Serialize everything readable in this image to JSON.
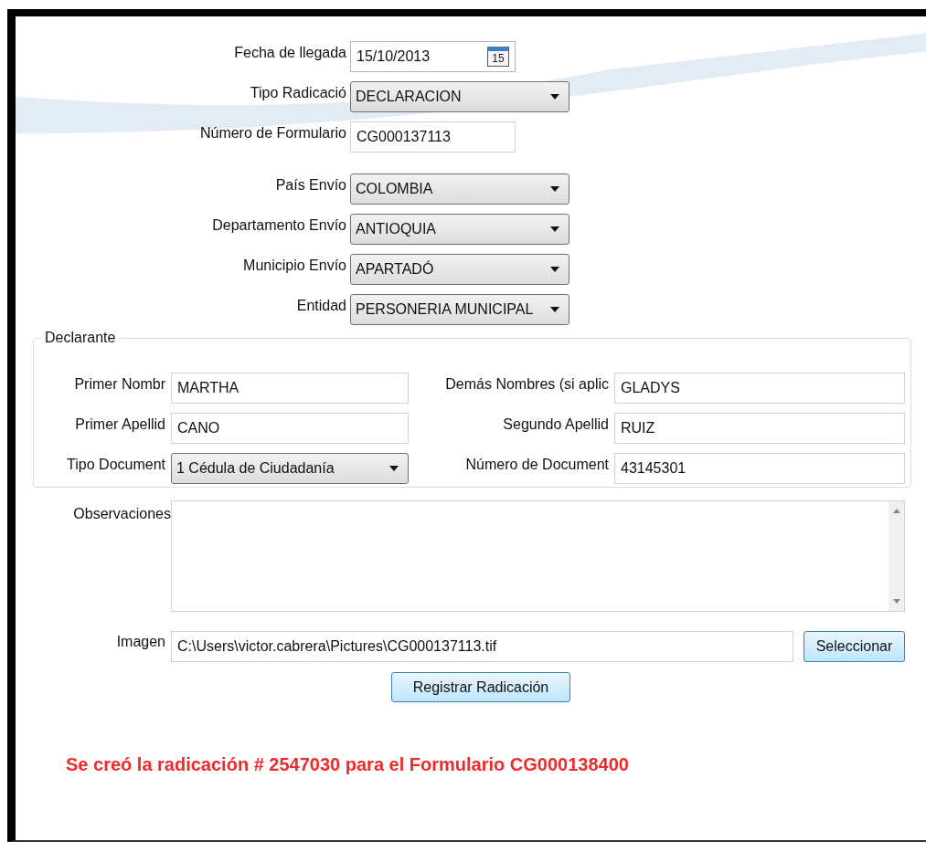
{
  "form": {
    "fields": [
      {
        "label": "Fecha de llegada",
        "kind": "date",
        "value": "15/10/2013",
        "calendar_day": "15"
      },
      {
        "label": "Tipo Radicació",
        "kind": "dropdown",
        "value": "DECLARACION"
      },
      {
        "label": "Número de Formulario",
        "kind": "text",
        "value": "CG000137113"
      },
      {
        "label": "País Envío",
        "kind": "dropdown",
        "value": "COLOMBIA"
      },
      {
        "label": "Departamento Envío",
        "kind": "dropdown",
        "value": "ANTIOQUIA"
      },
      {
        "label": "Municipio Envío",
        "kind": "dropdown",
        "value": "APARTADÓ"
      },
      {
        "label": "Entidad",
        "kind": "dropdown",
        "value": "PERSONERIA MUNICIPAL"
      }
    ]
  },
  "declarante": {
    "title": "Declarante",
    "fields": [
      {
        "label": "Primer Nombr",
        "kind": "text",
        "value": "MARTHA"
      },
      {
        "label": "Demás Nombres (si aplic",
        "kind": "text",
        "value": "GLADYS"
      },
      {
        "label": "Primer Apellid",
        "kind": "text",
        "value": "CANO"
      },
      {
        "label": "Segundo Apellid",
        "kind": "text",
        "value": "RUIZ"
      },
      {
        "label": "Tipo Document",
        "kind": "dropdown",
        "value": "1 Cédula de Ciudadanía"
      },
      {
        "label": "Número de Document",
        "kind": "text",
        "value": "43145301"
      }
    ]
  },
  "observaciones": {
    "label": "Observaciones"
  },
  "imagen": {
    "label": "Imagen",
    "value": "C:\\Users\\victor.cabrera\\Pictures\\CG000137113.tif",
    "button": "Seleccionar"
  },
  "submit_button": "Registrar Radicación",
  "message": "Se creó la radicación # 2547030 para el Formulario CG000138400"
}
